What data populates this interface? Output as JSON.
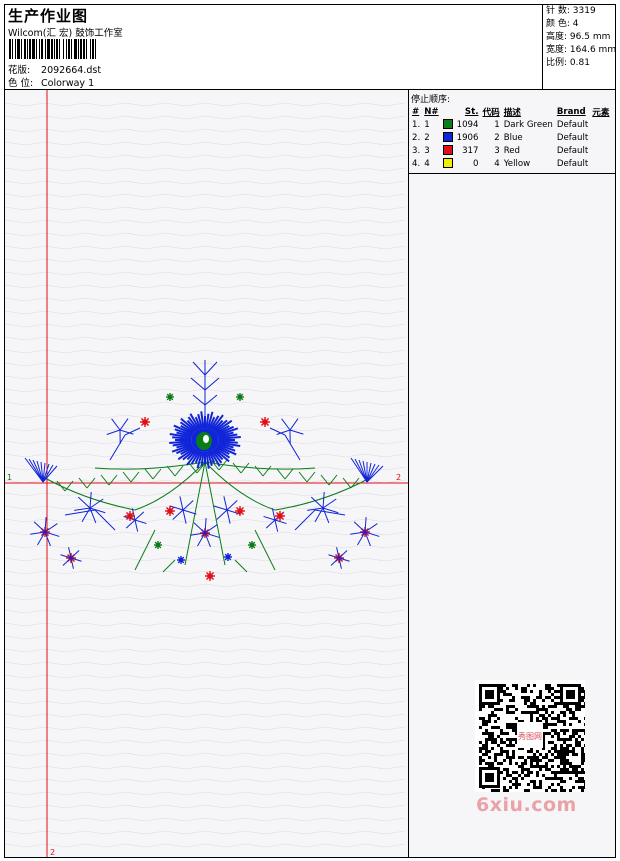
{
  "header": {
    "title": "生产作业图",
    "subtitle": "Wilcom(汇 宏) 鼓饰工作室",
    "design_label": "花版:",
    "design_value": "2092664.dst",
    "colorway_label": "色 位:",
    "colorway_value": "Colorway 1"
  },
  "stats": [
    {
      "label": "针 数:",
      "value": "3319"
    },
    {
      "label": "颜 色:",
      "value": "4"
    },
    {
      "label": "高度:",
      "value": "96.5 mm"
    },
    {
      "label": "宽度:",
      "value": "164.6 mm"
    },
    {
      "label": "比例:",
      "value": "0.81"
    }
  ],
  "stop_sequence": {
    "heading": "停止顺序:",
    "columns": [
      "#",
      "N#",
      "St.",
      "代码",
      "描述",
      "Brand",
      "元素"
    ],
    "rows": [
      {
        "idx": "1.",
        "n": "1",
        "color": "#0a7d18",
        "stitches": "1094",
        "code": "1",
        "desc": "Dark Green",
        "brand": "Default"
      },
      {
        "idx": "2.",
        "n": "2",
        "color": "#1024d8",
        "stitches": "1906",
        "code": "2",
        "desc": "Blue",
        "brand": "Default"
      },
      {
        "idx": "3.",
        "n": "3",
        "color": "#e01018",
        "stitches": "317",
        "code": "3",
        "desc": "Red",
        "brand": "Default"
      },
      {
        "idx": "4.",
        "n": "4",
        "color": "#f0f000",
        "stitches": "0",
        "code": "4",
        "desc": "Yellow",
        "brand": "Default"
      }
    ]
  },
  "axes": {
    "x_start": "1",
    "x_end": "2",
    "y_end": "2"
  },
  "watermark": "6xiu.com",
  "qr_center": "秀图网"
}
